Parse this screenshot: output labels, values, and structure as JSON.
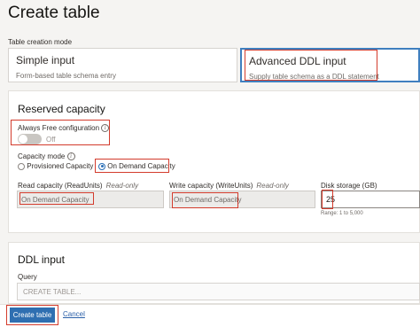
{
  "header": {
    "title": "Create table"
  },
  "mode": {
    "label": "Table creation mode",
    "simple": {
      "title": "Simple input",
      "subtitle": "Form-based table schema entry"
    },
    "advanced": {
      "title": "Advanced DDL input",
      "subtitle": "Supply table schema as a DDL statement"
    },
    "selected": "advanced"
  },
  "reserved": {
    "title": "Reserved capacity",
    "always_free_label": "Always Free configuration",
    "always_free_state": "Off",
    "capacity_mode_label": "Capacity mode",
    "options": [
      {
        "label": "Provisioned Capacity",
        "checked": false
      },
      {
        "label": "On Demand Capacity",
        "checked": true
      }
    ],
    "read_label": "Read capacity (ReadUnits)",
    "read_tag": "Read-only",
    "read_value": "On Demand Capacity",
    "write_label": "Write capacity (WriteUnits)",
    "write_tag": "Read-only",
    "write_value": "On Demand Capacity",
    "disk_label": "Disk storage (GB)",
    "disk_value": "25",
    "disk_hint": "Range: 1 to 5,000"
  },
  "ddl": {
    "title": "DDL input",
    "query_label": "Query",
    "query_placeholder": "CREATE TABLE..."
  },
  "footer": {
    "create_label": "Create table",
    "cancel_label": "Cancel"
  },
  "colors": {
    "primary": "#2f6fb1",
    "highlight": "#d33b2c",
    "selected_border": "#3f7fbf"
  },
  "icons": [
    "info-icon",
    "toggle-switch",
    "radio-button"
  ]
}
